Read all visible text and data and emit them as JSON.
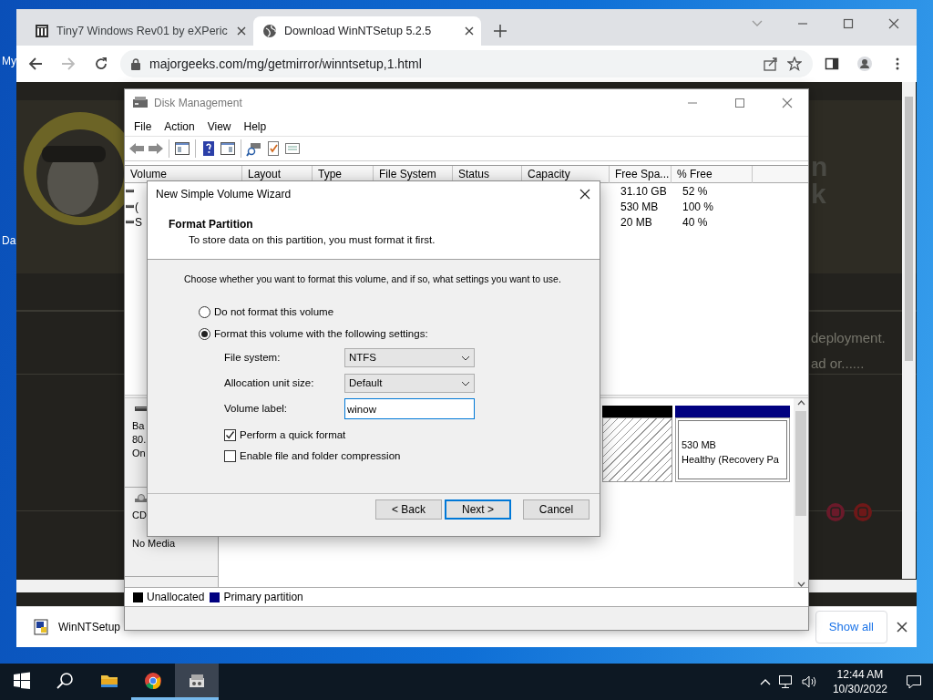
{
  "desktop": {
    "icon_labels": [
      "My",
      "Da"
    ]
  },
  "browser": {
    "tabs": [
      {
        "title": "Tiny7 Windows Rev01 by eXPeric",
        "selected": false
      },
      {
        "title": "Download WinNTSetup 5.2.5",
        "selected": true
      }
    ],
    "url": "majorgeeks.com/mg/getmirror/winntsetup,1.html",
    "page_fragments": [
      "n",
      "k",
      "deployment.",
      "ad or......"
    ],
    "download": {
      "file": "WinNTSetup"
    },
    "show_all": "Show all"
  },
  "disk_management": {
    "title": "Disk Management",
    "menu": [
      "File",
      "Action",
      "View",
      "Help"
    ],
    "columns": [
      "Volume",
      "Layout",
      "Type",
      "File System",
      "Status",
      "Capacity",
      "Free Spa...",
      "% Free"
    ],
    "rows": [
      {
        "free": "31.10 GB",
        "percent": "52 %"
      },
      {
        "volume": "(",
        "free": "530 MB",
        "percent": "100 %"
      },
      {
        "volume": "S",
        "free": "20 MB",
        "percent": "40 %"
      }
    ],
    "disks": [
      {
        "kind": "hdd",
        "lines": [
          "Ba",
          "80.",
          "On"
        ]
      },
      {
        "kind": "cd",
        "lines": [
          "CD",
          "No Media"
        ]
      }
    ],
    "partitions": [
      {
        "kind": "unallocated"
      },
      {
        "kind": "primary",
        "size": "530 MB",
        "status": "Healthy (Recovery Pa"
      }
    ],
    "legend": [
      {
        "label": "Unallocated",
        "color": "#000000"
      },
      {
        "label": "Primary partition",
        "color": "#000080"
      }
    ]
  },
  "wizard": {
    "title": "New Simple Volume Wizard",
    "heading": "Format Partition",
    "subheading": "To store data on this partition, you must format it first.",
    "prompt": "Choose whether you want to format this volume, and if so, what settings you want to use.",
    "options": [
      {
        "label": "Do not format this volume",
        "selected": false
      },
      {
        "label": "Format this volume with the following settings:",
        "selected": true
      }
    ],
    "fields": [
      {
        "kind": "select",
        "label": "File system:",
        "value": "NTFS"
      },
      {
        "kind": "select",
        "label": "Allocation unit size:",
        "value": "Default"
      },
      {
        "kind": "text",
        "label": "Volume label:",
        "value": "winow"
      }
    ],
    "checkboxes": [
      {
        "label": "Perform a quick format",
        "checked": true
      },
      {
        "label": "Enable file and folder compression",
        "checked": false
      }
    ],
    "buttons": [
      {
        "label": "< Back",
        "default": false
      },
      {
        "label": "Next >",
        "default": true
      },
      {
        "label": "Cancel",
        "default": false
      }
    ]
  },
  "taskbar": {
    "apps": [
      {
        "kind": "explorer",
        "running": false,
        "selected": false
      },
      {
        "kind": "chrome",
        "running": true,
        "selected": false
      },
      {
        "kind": "disk-management",
        "running": true,
        "selected": true
      }
    ],
    "time": "12:44 AM",
    "date": "10/30/2022"
  }
}
